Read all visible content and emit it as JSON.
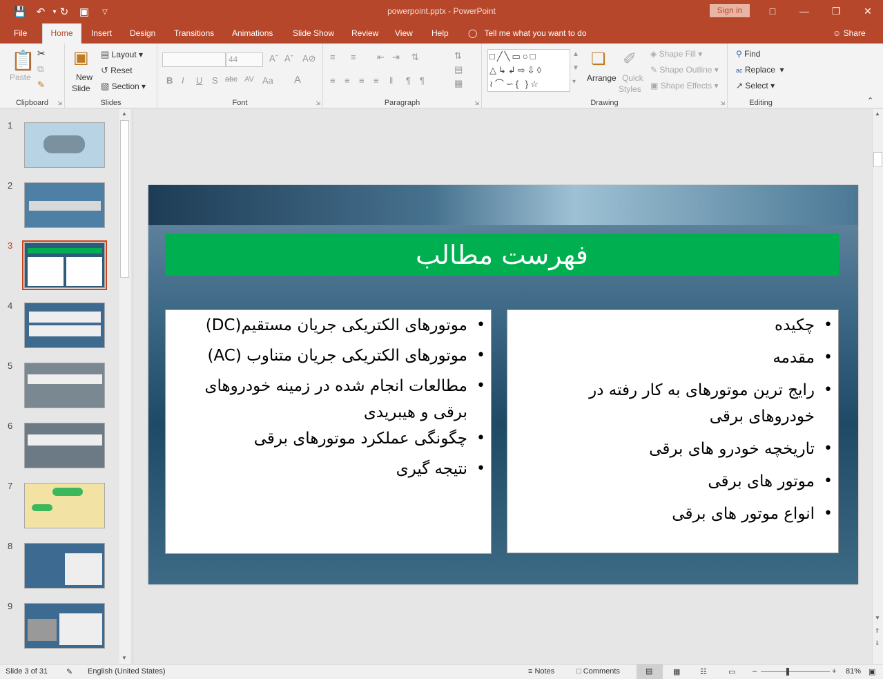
{
  "window": {
    "title": "powerpoint.pptx  -  PowerPoint",
    "signin_label": "Sign in",
    "qat_icons": [
      "save-icon",
      "undo-icon",
      "redo-icon",
      "presentation-icon",
      "customize-icon"
    ]
  },
  "tabs": [
    "File",
    "Home",
    "Insert",
    "Design",
    "Transitions",
    "Animations",
    "Slide Show",
    "Review",
    "View",
    "Help"
  ],
  "active_tab": "Home",
  "tellme": "Tell me what you want to do",
  "share": "Share",
  "ribbon": {
    "clipboard": {
      "label": "Clipboard",
      "paste": "Paste"
    },
    "slides": {
      "label": "Slides",
      "new_slide_line1": "New",
      "new_slide_line2": "Slide",
      "layout": "Layout",
      "reset": "Reset",
      "section": "Section"
    },
    "font": {
      "label": "Font",
      "font_name": "",
      "font_size": "44"
    },
    "paragraph": {
      "label": "Paragraph"
    },
    "drawing": {
      "label": "Drawing",
      "arrange": "Arrange",
      "quick_styles_1": "Quick",
      "quick_styles_2": "Styles",
      "shape_fill": "Shape Fill",
      "shape_outline": "Shape Outline",
      "shape_effects": "Shape Effects"
    },
    "editing": {
      "label": "Editing",
      "find": "Find",
      "replace": "Replace",
      "select": "Select"
    }
  },
  "thumbnails": [
    {
      "num": "1",
      "bg": "#b8d4e4"
    },
    {
      "num": "2",
      "bg": "#4e7fa4"
    },
    {
      "num": "3",
      "bg": "#2e5a7c",
      "selected": true
    },
    {
      "num": "4",
      "bg": "#3e6a90"
    },
    {
      "num": "5",
      "bg": "#7a8892"
    },
    {
      "num": "6",
      "bg": "#6c7a86"
    },
    {
      "num": "7",
      "bg": "#f2e2a4"
    },
    {
      "num": "8",
      "bg": "#3c6a90"
    },
    {
      "num": "9",
      "bg": "#3c6a90"
    }
  ],
  "slide": {
    "title": "فهرست مطالب",
    "right_items": [
      "چکیده",
      "مقدمه",
      "رایج ترین موتورهای به کار رفته در خودروهای برقی",
      "تاریخچه خودرو های برقی",
      "موتور های برقی",
      "انواع موتور های برقی"
    ],
    "left_items": [
      "موتورهای الکتریکی جریان مستقیم(DC)",
      "موتورهای الکتریکی جریان متناوب (AC)",
      "مطالعات انجام شده در زمینه خودروهای برقی و هیبریدی",
      "چگونگی عملکرد موتورهای برقی",
      "نتیجه گیری"
    ]
  },
  "status": {
    "slide_info": "Slide 3 of 31",
    "language": "English (United States)",
    "notes": "Notes",
    "comments": "Comments",
    "zoom": "81%"
  },
  "colors": {
    "accent": "#b7472a",
    "title_bar": "#00b050"
  }
}
